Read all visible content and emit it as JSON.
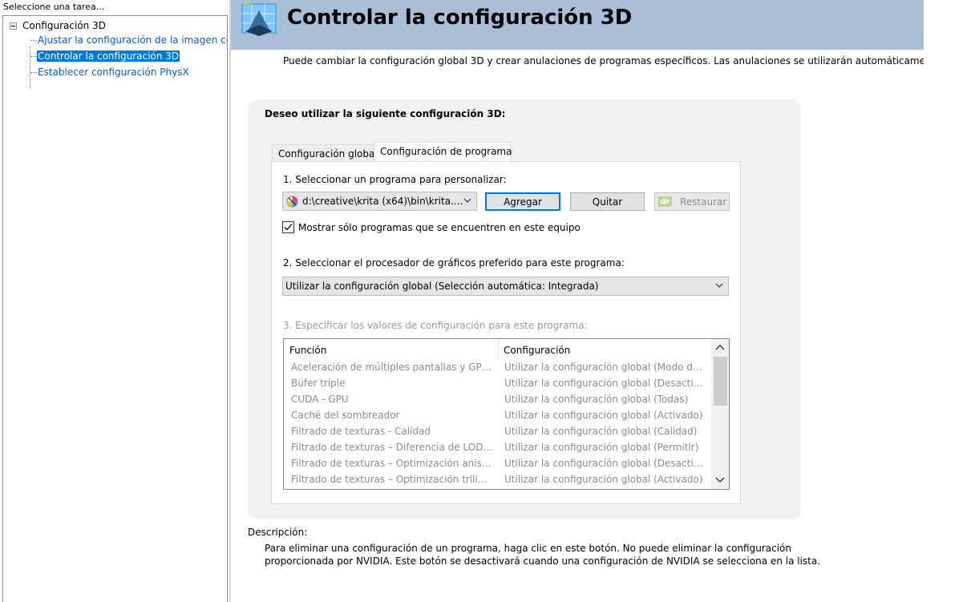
{
  "sidebar": {
    "header": "Seleccione una tarea...",
    "root_label": "Configuración 3D",
    "items": [
      {
        "label": "Ajustar la configuración de la imagen con vista previa"
      },
      {
        "label": "Controlar la configuración 3D",
        "selected": true
      },
      {
        "label": "Establecer configuración PhysX"
      }
    ]
  },
  "page": {
    "title": "Controlar la configuración 3D",
    "intro": "Puede cambiar la configuración global 3D y crear anulaciones de programas específicos. Las anulaciones se utilizarán automáticamente cada vez que se inicien los programas especificados."
  },
  "config": {
    "heading": "Deseo utilizar la siguiente configuración 3D:",
    "tabs": [
      {
        "label": "Configuración global",
        "active": false
      },
      {
        "label": "Configuración de programa",
        "active": true
      }
    ],
    "step1_label": "1. Seleccionar un programa para personalizar:",
    "program_value": "d:\\creative\\krita (x64)\\bin\\krita....",
    "add_label": "Agregar",
    "remove_label": "Quitar",
    "restore_label": "Restaurar",
    "show_only_label": "Mostrar sólo programas que se encuentren en este equipo",
    "show_only_checked": true,
    "step2_label": "2. Seleccionar el procesador de gráficos preferido para este programa:",
    "gpu_value": "Utilizar la configuración global (Selección automática: Integrada)",
    "step3_label": "3. Especificar los valores de configuración para este programa:",
    "columns": {
      "function": "Función",
      "setting": "Configuración"
    },
    "rows": [
      {
        "function": "Aceleración de múltiples pantallas y GPU ...",
        "setting": "Utilizar la configuración global (Modo de r..."
      },
      {
        "function": "Búfer triple",
        "setting": "Utilizar la configuración global (Desactiva..."
      },
      {
        "function": "CUDA - GPU",
        "setting": "Utilizar la configuración global (Todas)"
      },
      {
        "function": "Caché del sombreador",
        "setting": "Utilizar la configuración global (Activado)"
      },
      {
        "function": "Filtrado de texturas - Calidad",
        "setting": "Utilizar la configuración global (Calidad)"
      },
      {
        "function": "Filtrado de texturas – Diferencia de LOD ...",
        "setting": "Utilizar la configuración global (Permitir)"
      },
      {
        "function": "Filtrado de texturas – Optimización anisot...",
        "setting": "Utilizar la configuración global (Desactiva..."
      },
      {
        "function": "Filtrado de texturas – Optimización trilineal",
        "setting": "Utilizar la configuración global (Activado)"
      }
    ]
  },
  "description": {
    "label": "Descripción:",
    "text": "Para eliminar una configuración de un programa, haga clic en este botón. No puede eliminar la configuración proporcionada por NVIDIA. Este botón se desactivará cuando una configuración de NVIDIA se selecciona en la lista."
  },
  "colors": {
    "banner": "#a9bfd8",
    "selection": "#0078d7",
    "link": "#0b56c8",
    "nvidia_green": "#76b900"
  },
  "icons": [
    "nvidia-3d-icon",
    "krita-program-icon",
    "nvidia-logo-icon",
    "checkmark-icon",
    "chevron-down-icon",
    "chevron-up-icon"
  ]
}
